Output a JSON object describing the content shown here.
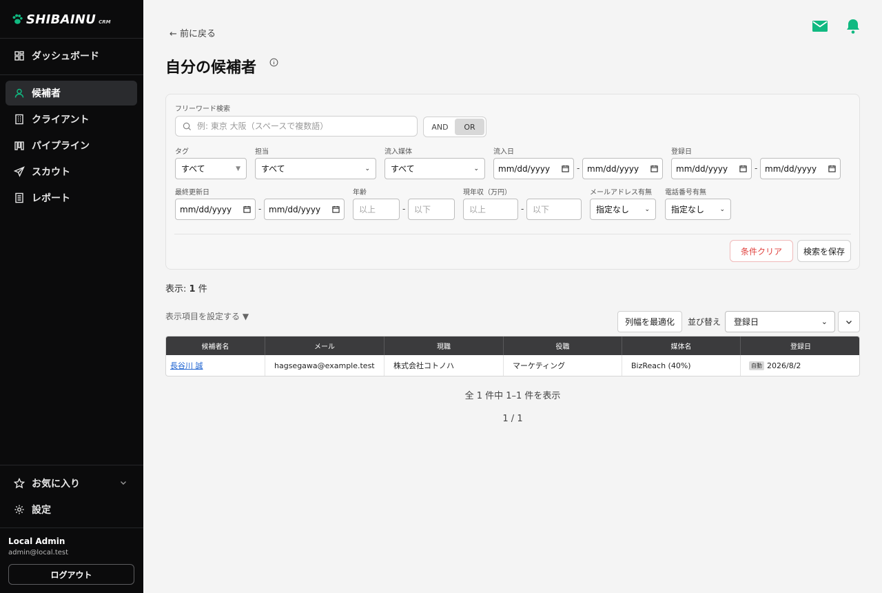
{
  "brand": {
    "name": "SHIBAINU",
    "suffix": "CRM"
  },
  "sidebar": {
    "items": [
      {
        "label": "ダッシュボード",
        "icon": "dashboard-icon"
      },
      {
        "label": "候補者",
        "icon": "person-icon",
        "active": true
      },
      {
        "label": "クライアント",
        "icon": "building-icon"
      },
      {
        "label": "パイプライン",
        "icon": "pipeline-icon"
      },
      {
        "label": "スカウト",
        "icon": "send-icon"
      },
      {
        "label": "レポート",
        "icon": "report-icon"
      }
    ],
    "favorites_label": "お気に入り",
    "settings_label": "設定",
    "user": {
      "name": "Local Admin",
      "email": "admin@local.test"
    },
    "logout_label": "ログアウト"
  },
  "colors": {
    "accent": "#10b981",
    "sidebar_bg": "#0b0b0c",
    "danger": "#e0413d",
    "link": "#1b61d1"
  },
  "header": {
    "back_label": "← 前に戻る",
    "title": "自分の候補者"
  },
  "filters": {
    "freeword_label": "フリーワード検索",
    "freeword_placeholder": "例: 東京 大阪（スペースで複数語）",
    "mode_and": "AND",
    "mode_or": "OR",
    "tag_label": "タグ",
    "tag_value": "すべて",
    "owner_label": "担当",
    "owner_value": "すべて",
    "source_label": "流入媒体",
    "source_value": "すべて",
    "inflow_date_label": "流入日",
    "registered_date_label": "登録日",
    "updated_date_label": "最終更新日",
    "date_placeholder": "mm/dd/yyyy",
    "age_label": "年齢",
    "income_label": "現年収（万円）",
    "min_placeholder": "以上",
    "max_placeholder": "以下",
    "email_label": "メールアドレス有無",
    "email_value": "指定なし",
    "phone_label": "電話番号有無",
    "phone_value": "指定なし",
    "dash": "-",
    "clear_label": "条件クリア",
    "save_label": "検索を保存"
  },
  "results": {
    "count_prefix": "表示: ",
    "count": "1",
    "count_suffix": " 件",
    "column_setting_label": "表示項目を設定する ▼",
    "fit_label": "列幅を最適化",
    "sort_label": "並び替え",
    "sort_value": "登録日"
  },
  "table": {
    "headers": [
      "候補者名",
      "メール",
      "現職",
      "役職",
      "媒体名",
      "登録日"
    ],
    "rows": [
      {
        "name": "長谷川 誠",
        "email": "hagsegawa@example.test",
        "company": "株式会社コトノハ",
        "role": "マーケティング",
        "media": "BizReach (40%)",
        "badge": "自動",
        "date": "2026/8/2"
      }
    ]
  },
  "pagination": {
    "summary": "全 1 件中 1–1 件を表示",
    "page": "1 / 1"
  }
}
